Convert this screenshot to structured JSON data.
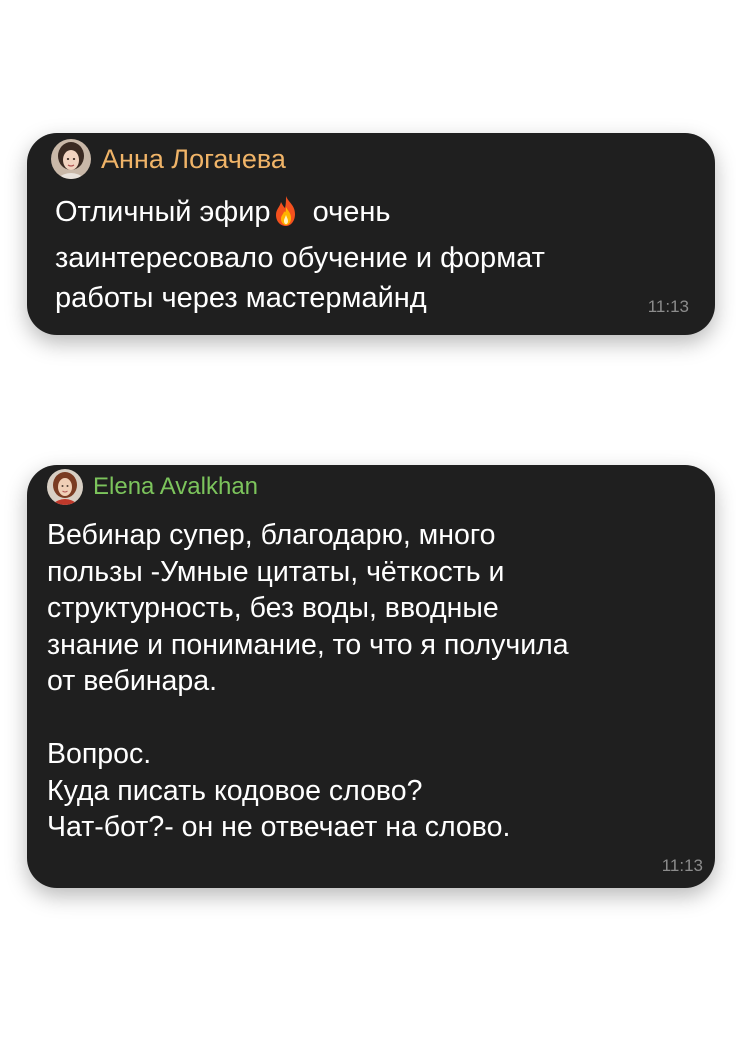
{
  "messages": [
    {
      "sender": "Анна Логачева",
      "sender_color": "#f0b468",
      "avatar": "female-avatar-photo",
      "text_before_emoji": "Отличный эфир",
      "emoji": "fire-emoji",
      "text_after_emoji": " очень\nзаинтересовало обучение и формат\nработы через мастермайнд",
      "time": "11:13"
    },
    {
      "sender": "Elena Avalkhan",
      "sender_color": "#7cc45c",
      "avatar": "female-avatar-photo",
      "text": "Вебинар супер, благодарю, много\nпользы -Умные цитаты, чёткость и\nструктурность, без воды, вводные\nзнание и понимание, то что я получила\nот вебинара.\n\nВопрос.\nКуда писать кодовое слово?\nЧат-бот?- он не отвечает на слово.",
      "time": "11:13"
    }
  ],
  "colors": {
    "bubble_background": "#1f1f1f",
    "message_text": "#ffffff",
    "timestamp": "#8c8c8c",
    "page_background": "#ffffff"
  }
}
